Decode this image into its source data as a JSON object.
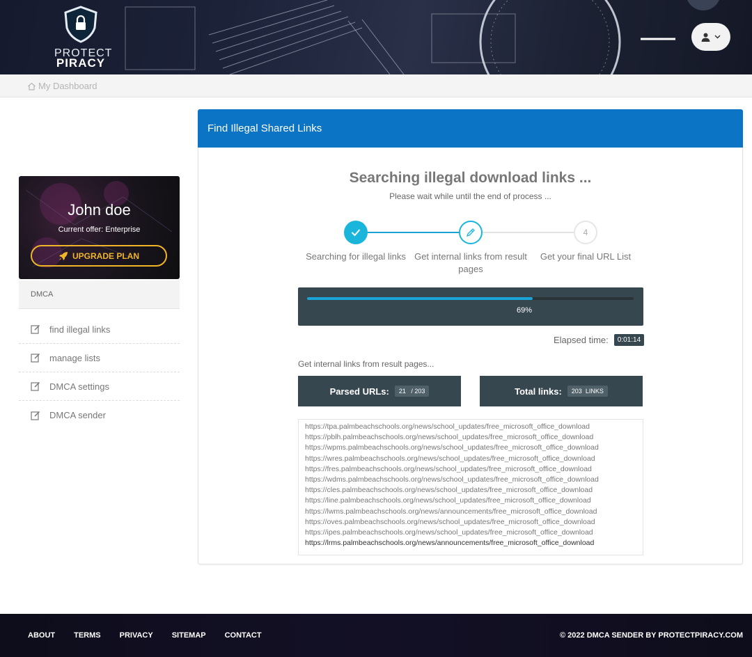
{
  "brand": {
    "line1": "PROTECT",
    "line2": "PIRACY",
    "shield_icon": "lock-shield-icon"
  },
  "header": {
    "user_menu_icon": "user-icon",
    "chevron": "chevron-down-icon"
  },
  "breadcrumb": {
    "label": "My Dashboard",
    "icon": "home-icon"
  },
  "profile": {
    "name": "John doe",
    "offer": "Current offer: Enterprise",
    "upgrade_label": "UPGRADE PLAN",
    "accent": "#f0b429"
  },
  "sidebar": {
    "section": "DMCA",
    "items": [
      {
        "label": "find illegal links",
        "icon": "edit-icon"
      },
      {
        "label": "manage lists",
        "icon": "edit-icon"
      },
      {
        "label": "DMCA settings",
        "icon": "edit-icon"
      },
      {
        "label": "DMCA sender",
        "icon": "edit-icon"
      }
    ]
  },
  "card": {
    "title": "Find Illegal Shared Links",
    "header_color": "#0b74c4",
    "heading": "Searching illegal download links ...",
    "subheading": "Please wait while until the end of process ...",
    "steps": [
      {
        "label": "Searching for illegal links",
        "state": "done",
        "icon": "check-icon"
      },
      {
        "label": "Get internal links from result pages",
        "state": "active",
        "icon": "pencil-icon"
      },
      {
        "label": "Get your final URL List",
        "state": "pending",
        "number": "4"
      }
    ],
    "progress": {
      "percent": 69,
      "label": "69%"
    },
    "elapsed": {
      "label": "Elapsed time:",
      "value": "0:01:14"
    },
    "section_label": "Get internal links from result pages...",
    "parsed": {
      "label": "Parsed URLs:",
      "value": "21",
      "total": "/ 203"
    },
    "total_links": {
      "label": "Total links:",
      "value": "203",
      "unit": "LINKS"
    },
    "urls": [
      "https://tpa.palmbeachschools.org/news/school_updates/free_microsoft_office_download",
      "https://pblh.palmbeachschools.org/news/school_updates/free_microsoft_office_download",
      "https://wpms.palmbeachschools.org/news/school_updates/free_microsoft_office_download",
      "https://wres.palmbeachschools.org/news/school_updates/free_microsoft_office_download",
      "https://fres.palmbeachschools.org/news/school_updates/free_microsoft_office_download",
      "https://wdms.palmbeachschools.org/news/school_updates/free_microsoft_office_download",
      "https://cles.palmbeachschools.org/news/school_updates/free_microsoft_office_download",
      "https://line.palmbeachschools.org/news/school_updates/free_microsoft_office_download",
      "https://lwms.palmbeachschools.org/news/announcements/free_microsoft_office_download",
      "https://oves.palmbeachschools.org/news/school_updates/free_microsoft_office_download",
      "https://ipes.palmbeachschools.org/news/school_updates/free_microsoft_office_download",
      "https://lrms.palmbeachschools.org/news/announcements/free_microsoft_office_download"
    ]
  },
  "footer": {
    "links": [
      "ABOUT",
      "TERMS",
      "PRIVACY",
      "SITEMAP",
      "CONTACT"
    ],
    "copyright": "© 2022 DMCA SENDER BY PROTECTPIRACY.COM"
  }
}
